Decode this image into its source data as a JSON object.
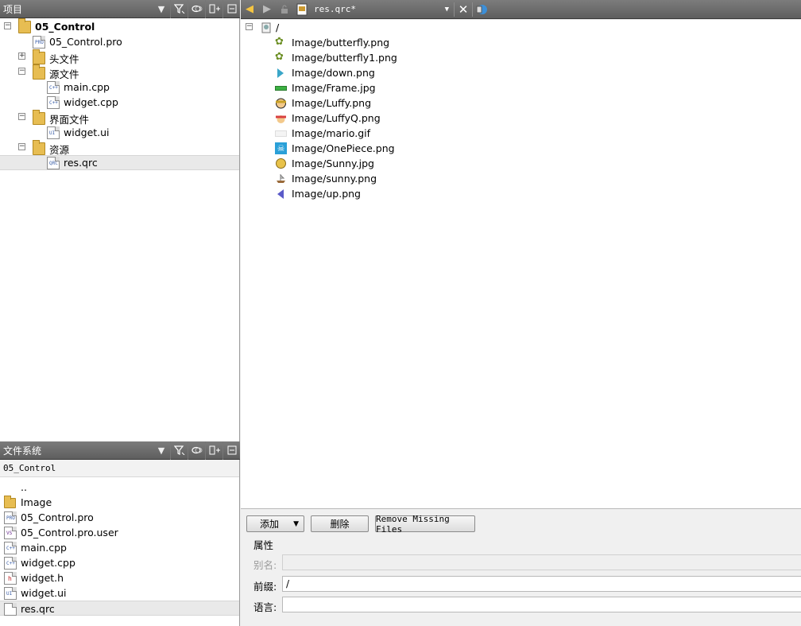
{
  "project_panel": {
    "title": "项目",
    "tree": {
      "root": "05_Control",
      "pro_file": "05_Control.pro",
      "headers": "头文件",
      "sources": "源文件",
      "source_files": [
        "main.cpp",
        "widget.cpp"
      ],
      "forms": "界面文件",
      "form_files": [
        "widget.ui"
      ],
      "resources": "资源",
      "resource_files": [
        "res.qrc"
      ]
    }
  },
  "fs_panel": {
    "title": "文件系统",
    "path": "05_Control",
    "items": [
      "..",
      "Image",
      "05_Control.pro",
      "05_Control.pro.user",
      "main.cpp",
      "widget.cpp",
      "widget.h",
      "widget.ui",
      "res.qrc"
    ]
  },
  "editor": {
    "document": "res.qrc*",
    "prefix": "/",
    "files": [
      "Image/butterfly.png",
      "Image/butterfly1.png",
      "Image/down.png",
      "Image/Frame.jpg",
      "Image/Luffy.png",
      "Image/LuffyQ.png",
      "Image/mario.gif",
      "Image/OnePiece.png",
      "Image/Sunny.jpg",
      "Image/sunny.png",
      "Image/up.png"
    ],
    "add_label": "添加",
    "remove_label": "删除",
    "remove_missing_label": "Remove Missing Files",
    "properties_label": "属性",
    "alias_label": "别名:",
    "alias_value": "",
    "prefix_label": "前缀:",
    "prefix_value": "/",
    "lang_label": "语言:",
    "lang_value": ""
  }
}
